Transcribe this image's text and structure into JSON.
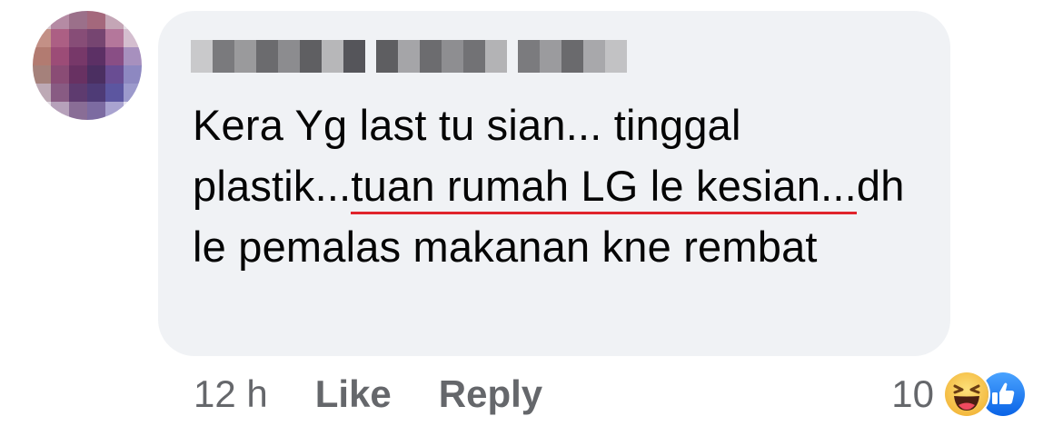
{
  "comment": {
    "author_name": "",
    "text_parts": [
      {
        "text": "Kera Yg last tu sian... tinggal plastik...",
        "underlined": false
      },
      {
        "text": "tuan rumah LG le kesian...",
        "underlined": true
      },
      {
        "text": "dh le pemalas makanan kne rembat",
        "underlined": false
      }
    ],
    "timestamp": "12 h",
    "like_label": "Like",
    "reply_label": "Reply",
    "reaction_count": "10",
    "reactions": [
      "haha-icon",
      "like-icon"
    ]
  },
  "colors": {
    "bubble_bg": "#f0f2f5",
    "text": "#050505",
    "meta_text": "#65676b",
    "underline": "#e0242c",
    "like_blue": "#1877f2",
    "haha_yellow": "#f7c544"
  }
}
